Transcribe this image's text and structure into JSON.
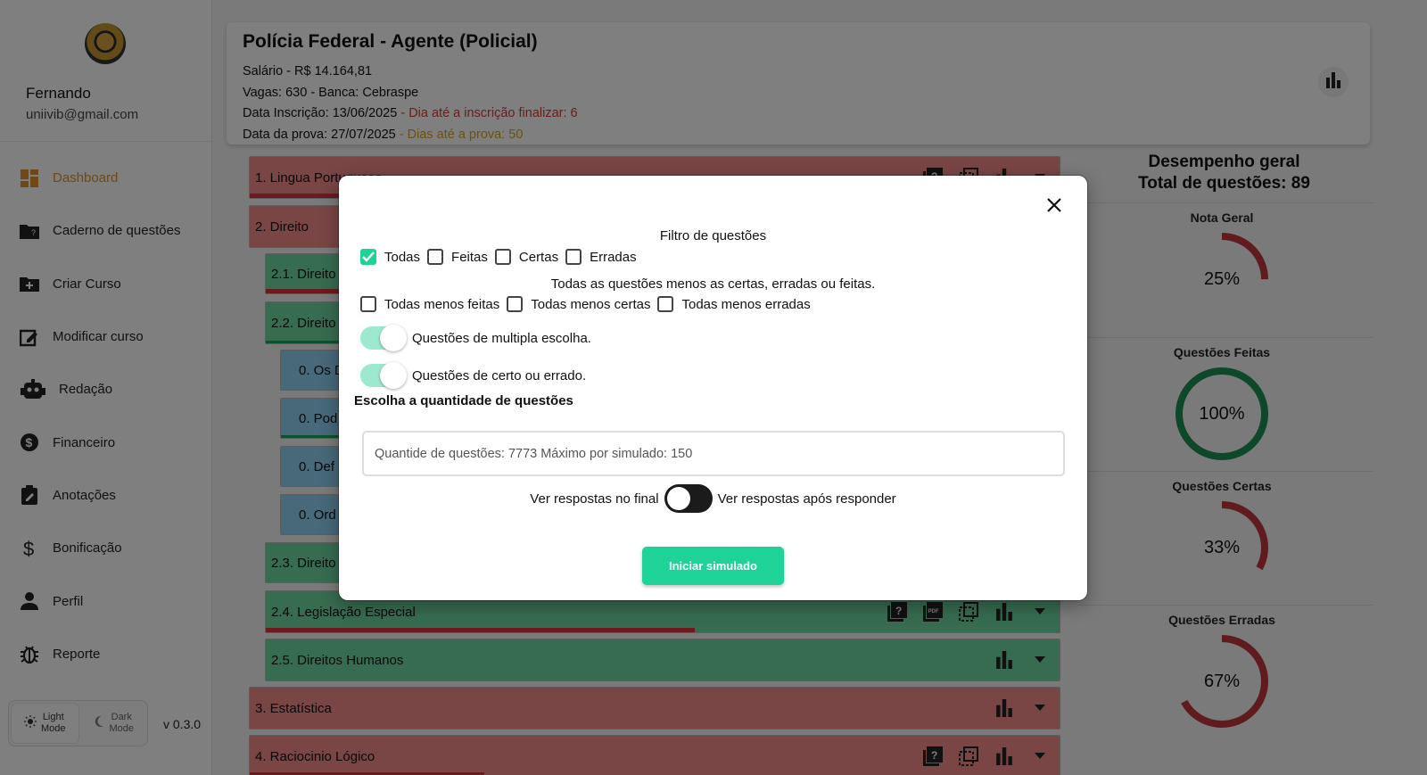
{
  "sidebar": {
    "user_name": "Fernando",
    "user_email": "uniivib@gmail.com",
    "items": [
      {
        "label": "Dashboard",
        "icon": "dashboard-icon",
        "active": true
      },
      {
        "label": "Caderno de  questões",
        "icon": "folder-icon"
      },
      {
        "label": "Criar Curso",
        "icon": "create-folder-icon"
      },
      {
        "label": "Modificar curso",
        "icon": "edit-icon"
      },
      {
        "label": "Redação",
        "icon": "robot-icon"
      },
      {
        "label": "Financeiro",
        "icon": "money-icon"
      },
      {
        "label": "Anotações",
        "icon": "clipboard-icon"
      },
      {
        "label": "Bonificação",
        "icon": "dollar-icon"
      },
      {
        "label": "Perfil",
        "icon": "person-icon"
      },
      {
        "label": "Reporte",
        "icon": "bug-icon"
      }
    ],
    "theme": {
      "light": "Light\nMode",
      "light_l1": "Light",
      "light_l2": "Mode",
      "dark_l1": "Dark",
      "dark_l2": "Mode"
    },
    "version": "v 0.3.0"
  },
  "header": {
    "title": "Polícia Federal - Agente (Policial)",
    "salary": "Salário - R$ 14.164,81",
    "vagas": "Vagas:   630 - Banca: Cebraspe",
    "inscricao_label": "Data Inscrição:  13/06/2025",
    "inscricao_sep": "  -  ",
    "inscricao_remaining": "Dia até a inscrição finalizar:  6",
    "prova_label": "Data da prova:  27/07/2025",
    "prova_sep": "  -  ",
    "prova_remaining": "Dias até a prova:  50"
  },
  "subjects": [
    {
      "label": "1. Lingua Portuguesa",
      "color": "red"
    },
    {
      "label": "2. Direito",
      "color": "red"
    },
    {
      "label": "2.1. Direito",
      "color": "green"
    },
    {
      "label": "2.2. Direito",
      "color": "green"
    },
    {
      "label": "0. Os D",
      "color": "blue"
    },
    {
      "label": "0. Pod",
      "color": "blue"
    },
    {
      "label": "0. Def",
      "color": "blue"
    },
    {
      "label": "0. Ord",
      "color": "blue"
    },
    {
      "label": "2.3. Direito",
      "color": "green"
    },
    {
      "label": "2.4. Legislação Especial",
      "color": "green"
    },
    {
      "label": "2.5. Direitos Humanos",
      "color": "green"
    },
    {
      "label": "3. Estatística",
      "color": "red"
    },
    {
      "label": "4. Raciocinio Lógico",
      "color": "red"
    }
  ],
  "stats": {
    "title_line1": "Desempenho geral",
    "title_line2": "Total de questões: 89",
    "gauges": [
      {
        "label": "Nota Geral",
        "value_text": "25%",
        "fraction": 0.25,
        "color": "#c0363f"
      },
      {
        "label": "Questões Feitas",
        "value_text": "100%",
        "fraction": 1.0,
        "color": "#1c8f55"
      },
      {
        "label": "Questões Certas",
        "value_text": "33%",
        "fraction": 0.33,
        "color": "#c0363f"
      },
      {
        "label": "Questões Erradas",
        "value_text": "67%",
        "fraction": 0.67,
        "color": "#c0363f"
      }
    ]
  },
  "modal": {
    "title": "Filtro de questões",
    "filters": [
      {
        "label": "Todas",
        "checked": true
      },
      {
        "label": "Feitas",
        "checked": false
      },
      {
        "label": "Certas",
        "checked": false
      },
      {
        "label": "Erradas",
        "checked": false
      }
    ],
    "note": "Todas as questões menos as certas, erradas ou feitas.",
    "exclusions": [
      {
        "label": "Todas menos feitas",
        "checked": false
      },
      {
        "label": "Todas menos certas",
        "checked": false
      },
      {
        "label": "Todas menos erradas",
        "checked": false
      }
    ],
    "toggle_multiple": "Questões de multipla escolha.",
    "toggle_certo_errado": "Questões de certo ou errado.",
    "quantity_heading": "Escolha a quantidade de questões",
    "quantity_placeholder": "Quantide de questões: 7773 Máximo por simulado: 150",
    "answers_left": "Ver respostas  no final",
    "answers_right": "Ver respostas após responder",
    "start_button": "Iniciar simulado"
  }
}
